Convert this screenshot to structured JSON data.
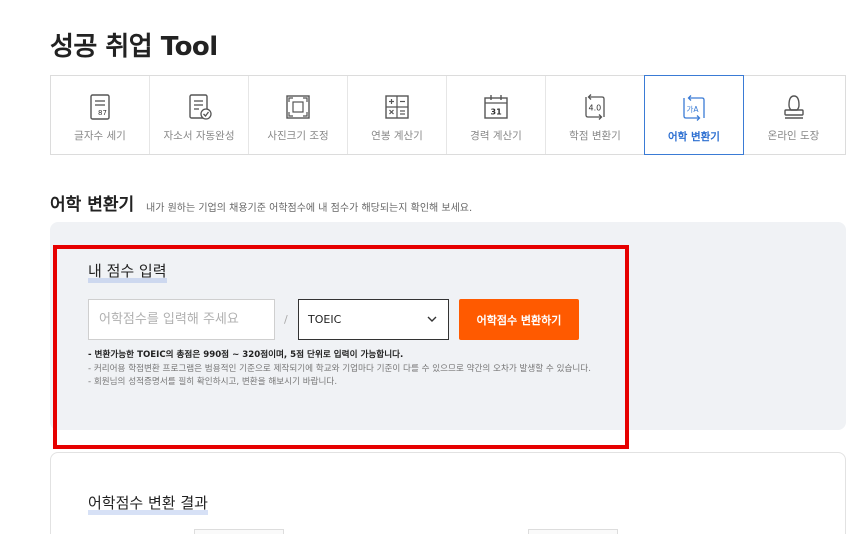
{
  "page": {
    "title": "성공 취업 Tool"
  },
  "tools": [
    {
      "id": "char-count",
      "label": "글자수 세기",
      "icon": "document-count-icon",
      "icon_text": "87",
      "active": false
    },
    {
      "id": "essay-complete",
      "label": "자소서 자동완성",
      "icon": "document-check-icon",
      "active": false
    },
    {
      "id": "photo-resize",
      "label": "사진크기 조정",
      "icon": "resize-icon",
      "active": false
    },
    {
      "id": "salary-calc",
      "label": "연봉 계산기",
      "icon": "calculator-icon",
      "active": false
    },
    {
      "id": "career-calc",
      "label": "경력 계산기",
      "icon": "calendar-icon",
      "icon_text": "31",
      "active": false
    },
    {
      "id": "gpa-convert",
      "label": "학점 변환기",
      "icon": "grade-convert-icon",
      "icon_text": "4.0",
      "active": false
    },
    {
      "id": "language-convert",
      "label": "어학 변환기",
      "icon": "translate-icon",
      "icon_text": "가A",
      "active": true
    },
    {
      "id": "online-stamp",
      "label": "온라인 도장",
      "icon": "stamp-icon",
      "active": false
    }
  ],
  "section": {
    "title": "어학 변환기",
    "description": "내가 원하는 기업의 채용기준 어학점수에 내 점수가 해당되는지 확인해 보세요."
  },
  "score_input": {
    "title": "내 점수 입력",
    "placeholder": "어학점수를 입력해 주세요",
    "value": "",
    "separator": "/",
    "exam_selected": "TOEIC",
    "convert_label": "어학점수 변환하기"
  },
  "notes": [
    "- 변환가능한 TOEIC의 총점은 990점 ~ 320점이며, 5점 단위로 입력이 가능합니다.",
    "- 커리어용 학점변환 프로그램은 범용적인 기준으로 제작되기에 학교와 기업마다 기준이 다를 수 있으므로 약간의 오차가 발생할 수 있습니다.",
    "- 회원님의 성적증명서를 필히 확인하시고, 변환을 해보시기 바랍니다."
  ],
  "result": {
    "title": "어학점수 변환 결과"
  },
  "colors": {
    "accent": "#ff5a00",
    "active_tab": "#3a7bd5",
    "highlight": "#e60000",
    "panel_bg": "#f0f2f5"
  }
}
